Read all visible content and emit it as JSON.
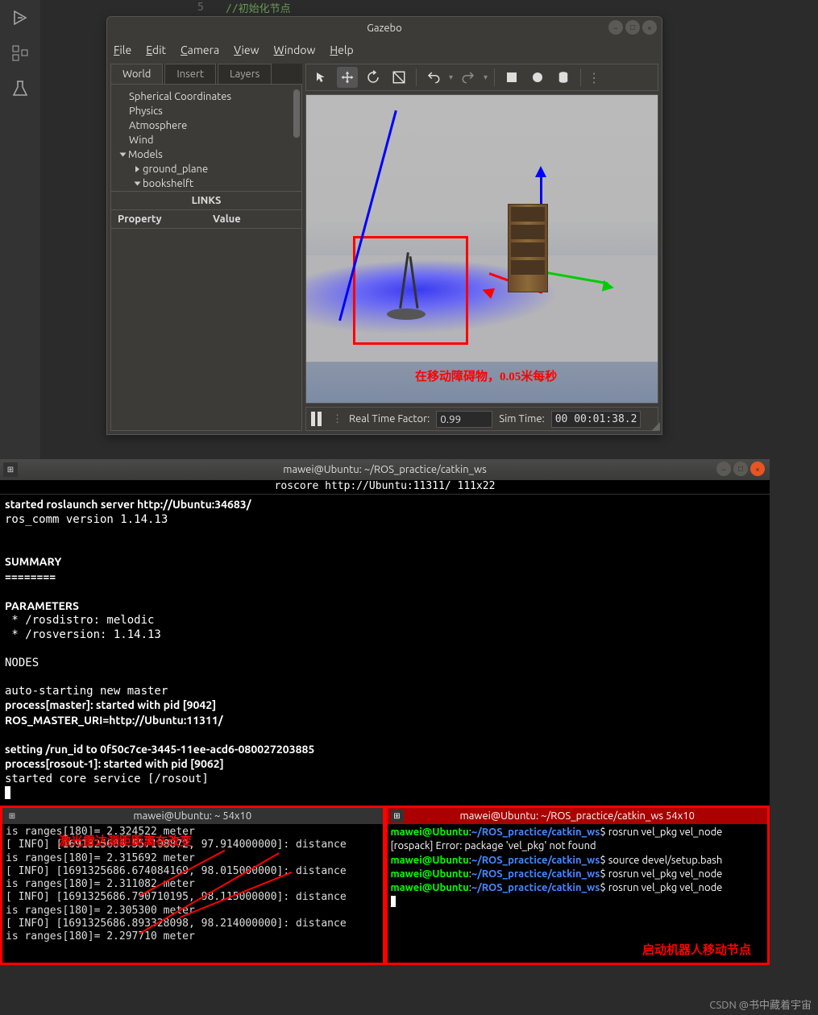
{
  "editor": {
    "comment": "//初始化节点",
    "line_no": "5"
  },
  "gazebo": {
    "title": "Gazebo",
    "menu": {
      "file": "File",
      "edit": "Edit",
      "camera": "Camera",
      "view": "View",
      "window": "Window",
      "help": "Help"
    },
    "tabs": {
      "world": "World",
      "insert": "Insert",
      "layers": "Layers"
    },
    "tree": {
      "spherical": "Spherical Coordinates",
      "physics": "Physics",
      "atmosphere": "Atmosphere",
      "wind": "Wind",
      "models": "Models",
      "ground_plane": "ground_plane",
      "bookshelft": "bookshelft",
      "links": "LINKS"
    },
    "props": {
      "property": "Property",
      "value": "Value"
    },
    "canvas_note": "在移动障碍物，0.05米每秒",
    "status": {
      "rtf_label": "Real Time Factor:",
      "rtf_value": "0.99",
      "sim_label": "Sim Time:",
      "sim_value": "00 00:01:38.2"
    }
  },
  "main_term": {
    "title": "mawei@Ubuntu: ~/ROS_practice/catkin_ws",
    "subtitle": "roscore http://Ubuntu:11311/ 111x22",
    "lines": [
      "started roslaunch server http://Ubuntu:34683/",
      "ros_comm version 1.14.13",
      "",
      "",
      "SUMMARY",
      "========",
      "",
      "PARAMETERS",
      " * /rosdistro: melodic",
      " * /rosversion: 1.14.13",
      "",
      "NODES",
      "",
      "auto-starting new master",
      "process[master]: started with pid [9042]",
      "ROS_MASTER_URI=http://Ubuntu:11311/",
      "",
      "setting /run_id to 0f50c7ce-3445-11ee-acd6-080027203885",
      "process[rosout-1]: started with pid [9062]",
      "started core service [/rosout]"
    ]
  },
  "left_term": {
    "title": "mawei@Ubuntu: ~ 54x10",
    "note": "激光雷达测距距离在改变",
    "lines": [
      "is ranges[180]= 2.324522 meter",
      "[ INFO] [1691325686.557108872, 97.914000000]: distance",
      "is ranges[180]= 2.315692 meter",
      "[ INFO] [1691325686.674084169, 98.015000000]: distance",
      "is ranges[180]= 2.311082 meter",
      "[ INFO] [1691325686.790710195, 98.115000000]: distance",
      "is ranges[180]= 2.305300 meter",
      "[ INFO] [1691325686.893328098, 98.214000000]: distance",
      "is ranges[180]= 2.297710 meter"
    ]
  },
  "right_term": {
    "title": "mawei@Ubuntu: ~/ROS_practice/catkin_ws 54x10",
    "note": "启动机器人移动节点",
    "prompt_user": "mawei@Ubuntu",
    "prompt_path": "~/ROS_practice/catkin_ws",
    "cmd1": "rosrun vel_pkg vel_node",
    "err": "[rospack] Error: package 'vel_pkg' not found",
    "cmd2": "source devel/setup.bash",
    "cmd3": "rosrun vel_pkg vel_node",
    "cmd4": "rosrun vel_pkg vel_node"
  },
  "watermark": "CSDN @书中藏着宇宙"
}
